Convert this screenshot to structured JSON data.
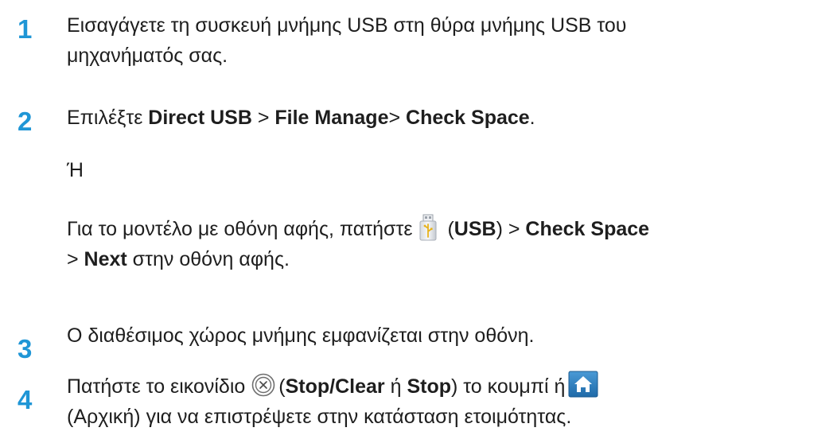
{
  "steps": [
    {
      "number": "1",
      "lines": [
        "Εισαγάγετε τη συσκευή μνήμης USB στη θύρα μνήμης USB του",
        "μηχανήματός σας."
      ]
    },
    {
      "number": "2",
      "line1": {
        "prefix": "Επιλέξτε ",
        "bold1": "Direct USB",
        "sep1": " > ",
        "bold2": "File Manage",
        "sep2": "> ",
        "bold3": "Check Space",
        "suffix": "."
      },
      "or": "Ή",
      "line3": {
        "prefix": "Για το μοντέλο με οθόνη αφής, πατήστε",
        "paren_open": "(",
        "bold1": "USB",
        "paren_close_sep": ") > ",
        "bold2": "Check Space"
      },
      "line4": {
        "sep": "> ",
        "bold": "Next",
        "suffix": " στην οθόνη αφής."
      }
    },
    {
      "number": "3",
      "text": "Ο διαθέσιμος χώρος μνήμης εμφανίζεται στην οθόνη."
    },
    {
      "number": "4",
      "line1": {
        "prefix": "Πατήστε το εικονίδιο",
        "paren_open": "(",
        "bold1": "Stop/Clear",
        "mid": " ή ",
        "bold2": "Stop",
        "suffix": ") το κουμπί ή"
      },
      "line2": "(Αρχική) για να επιστρέψετε στην κατάσταση ετοιμότητας."
    }
  ],
  "icons": {
    "usb": "usb-memory-icon",
    "stop": "stop-clear-icon",
    "home": "home-icon"
  },
  "colors": {
    "step_number": "#1f96d6",
    "text": "#1e1e1e",
    "home_icon_bg": "#2f7fc1"
  }
}
